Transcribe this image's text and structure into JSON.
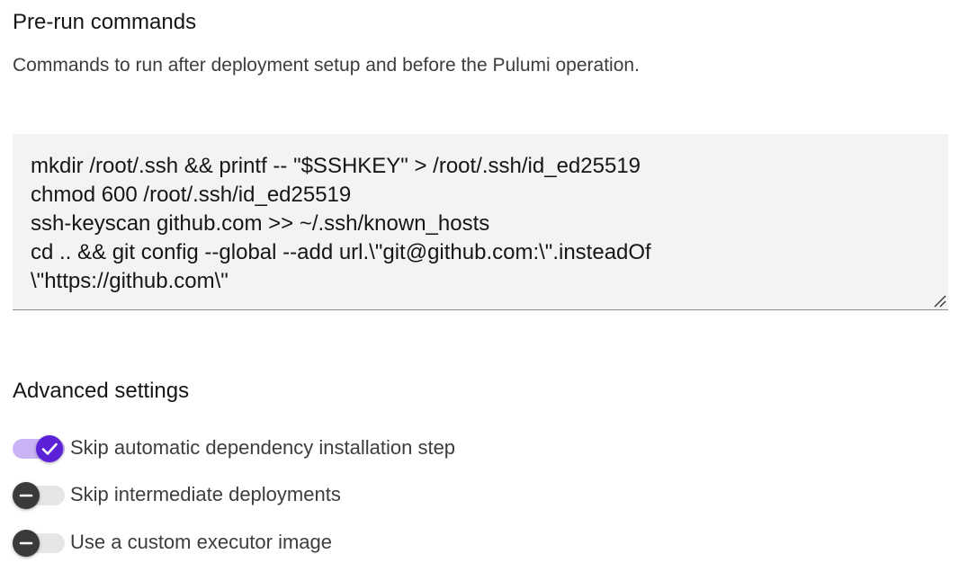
{
  "pre_run": {
    "title": "Pre-run commands",
    "description": "Commands to run after deployment setup and before the Pulumi operation.",
    "commands": "mkdir /root/.ssh && printf -- \"$SSHKEY\" > /root/.ssh/id_ed25519\nchmod 600 /root/.ssh/id_ed25519\nssh-keyscan github.com >> ~/.ssh/known_hosts\ncd .. && git config --global --add url.\\\"git@github.com:\\\".insteadOf\n\\\"https://github.com\\\""
  },
  "advanced": {
    "title": "Advanced settings",
    "toggles": [
      {
        "label": "Skip automatic dependency installation step",
        "checked": true,
        "icon": "checkmark-icon"
      },
      {
        "label": "Skip intermediate deployments",
        "checked": false,
        "icon": "minus-icon"
      },
      {
        "label": "Use a custom executor image",
        "checked": false,
        "icon": "minus-icon"
      }
    ]
  },
  "colors": {
    "accent": "#5b21d6",
    "accent_track": "#c9b3f5",
    "off_knob": "#3a3a3a",
    "off_track": "#e6e6e6",
    "field_bg": "#f3f3f3"
  }
}
